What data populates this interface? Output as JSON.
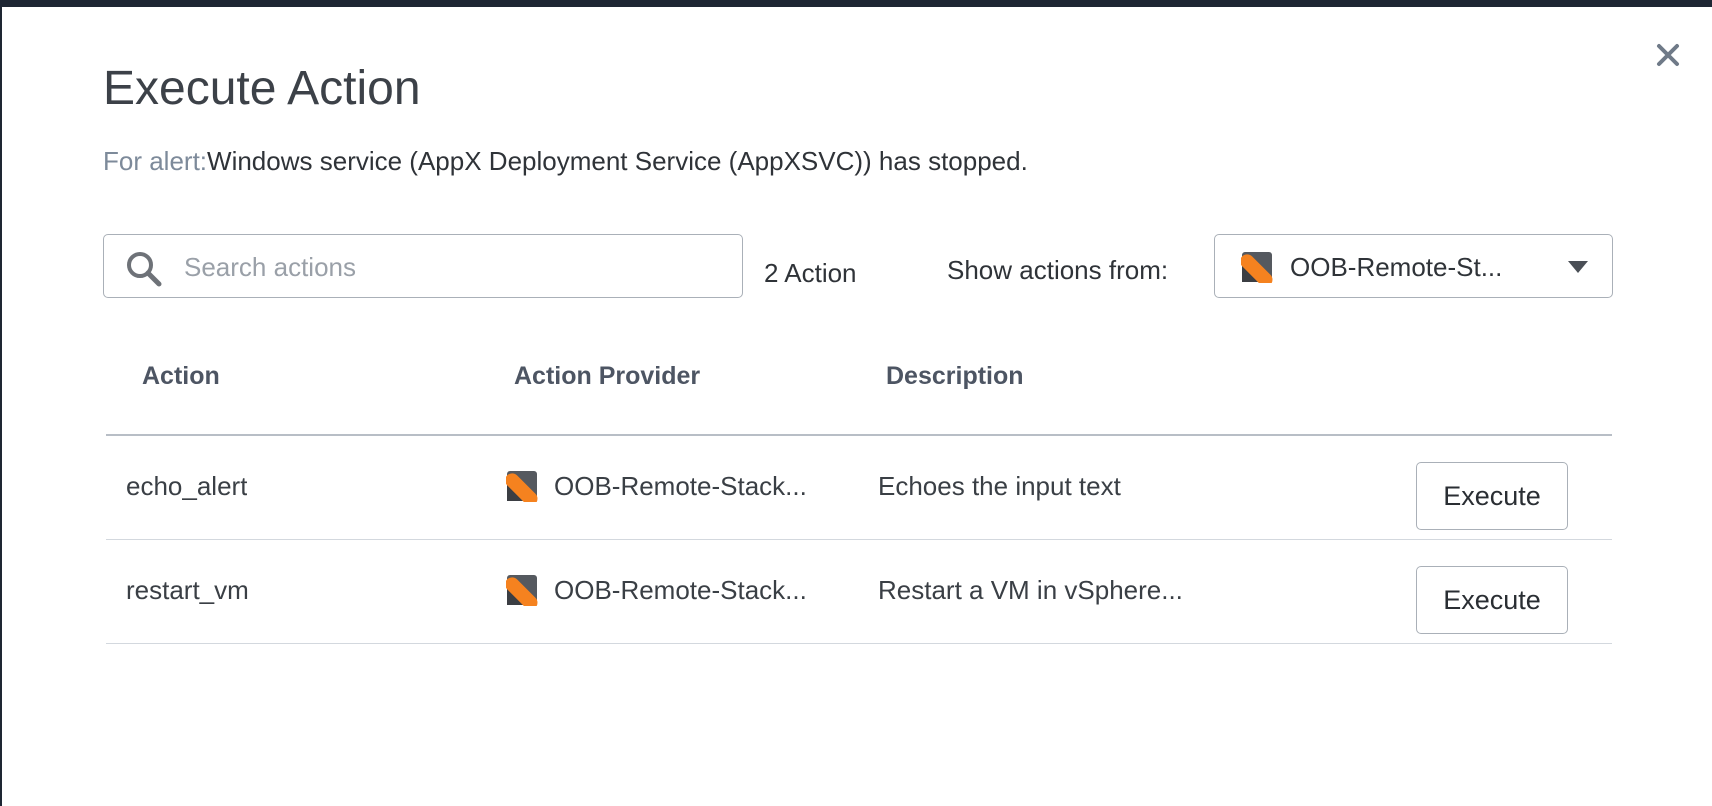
{
  "modal": {
    "title": "Execute Action",
    "alert_label": "For alert:",
    "alert_text": "Windows service (AppX Deployment Service (AppXSVC)) has stopped.",
    "close_icon": "close-icon"
  },
  "toolbar": {
    "search_placeholder": "Search actions",
    "search_value": "",
    "action_count": "2 Action",
    "show_from_label": "Show actions from:",
    "provider_selected": "OOB-Remote-St..."
  },
  "table": {
    "columns": [
      "Action",
      "Action Provider",
      "Description"
    ],
    "rows": [
      {
        "action": "echo_alert",
        "provider": "OOB-Remote-Stack...",
        "description": "Echoes the input text",
        "button": "Execute"
      },
      {
        "action": "restart_vm",
        "provider": "OOB-Remote-Stack...",
        "description": "Restart a VM in vSphere...",
        "button": "Execute"
      }
    ]
  },
  "colors": {
    "provider_logo_accent": "#f5821f",
    "provider_logo_dark": "#55595f",
    "label_muted": "#7d8a9a"
  }
}
